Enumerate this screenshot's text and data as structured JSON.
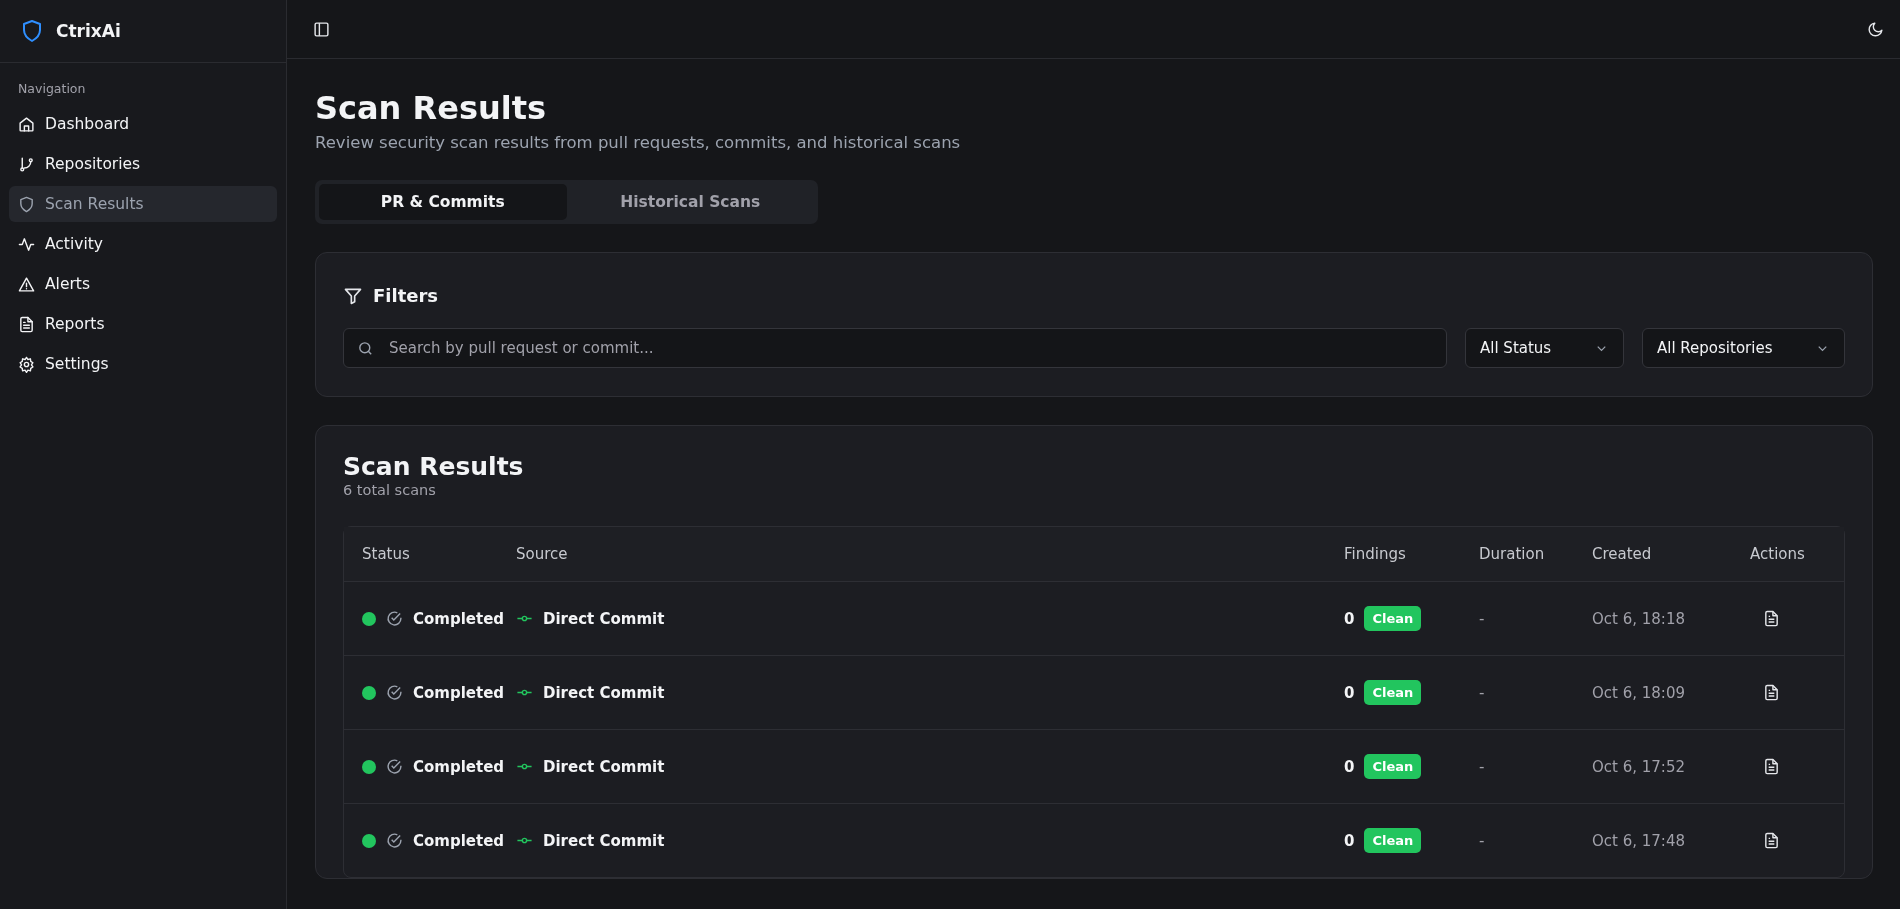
{
  "brand": {
    "name": "CtrixAi"
  },
  "sidebar": {
    "section": "Navigation",
    "items": [
      {
        "label": "Dashboard",
        "kind": "home",
        "selected": false
      },
      {
        "label": "Repositories",
        "kind": "branch",
        "selected": false
      },
      {
        "label": "Scan Results",
        "kind": "shield",
        "selected": true
      },
      {
        "label": "Activity",
        "kind": "pulse",
        "selected": false
      },
      {
        "label": "Alerts",
        "kind": "alert",
        "selected": false
      },
      {
        "label": "Reports",
        "kind": "doc",
        "selected": false
      },
      {
        "label": "Settings",
        "kind": "gear",
        "selected": false
      }
    ]
  },
  "page": {
    "title": "Scan Results",
    "subtitle": "Review security scan results from pull requests, commits, and historical scans"
  },
  "tabs": [
    {
      "label": "PR & Commits",
      "selected": true
    },
    {
      "label": "Historical Scans",
      "selected": false
    }
  ],
  "filters": {
    "title": "Filters",
    "search": {
      "placeholder": "Search by pull request or commit..."
    },
    "selects": [
      "All Status",
      "All Repositories"
    ]
  },
  "results": {
    "title": "Scan Results",
    "count": "6 total scans",
    "table": {
      "columns": [
        "Status",
        "Source",
        "Findings",
        "Duration",
        "Created",
        "Actions"
      ],
      "rows": [
        {
          "color": "#22c55e",
          "status": "Completed",
          "source": "Direct Commit",
          "findings": "0",
          "badge": "Clean",
          "duration": "-",
          "created": "Oct 6, 18:18"
        },
        {
          "color": "#22c55e",
          "status": "Completed",
          "source": "Direct Commit",
          "findings": "0",
          "badge": "Clean",
          "duration": "-",
          "created": "Oct 6, 18:09"
        },
        {
          "color": "#22c55e",
          "status": "Completed",
          "source": "Direct Commit",
          "findings": "0",
          "badge": "Clean",
          "duration": "-",
          "created": "Oct 6, 17:52"
        },
        {
          "color": "#22c55e",
          "status": "Completed",
          "source": "Direct Commit",
          "findings": "0",
          "badge": "Clean",
          "duration": "-",
          "created": "Oct 6, 17:48"
        }
      ]
    }
  }
}
